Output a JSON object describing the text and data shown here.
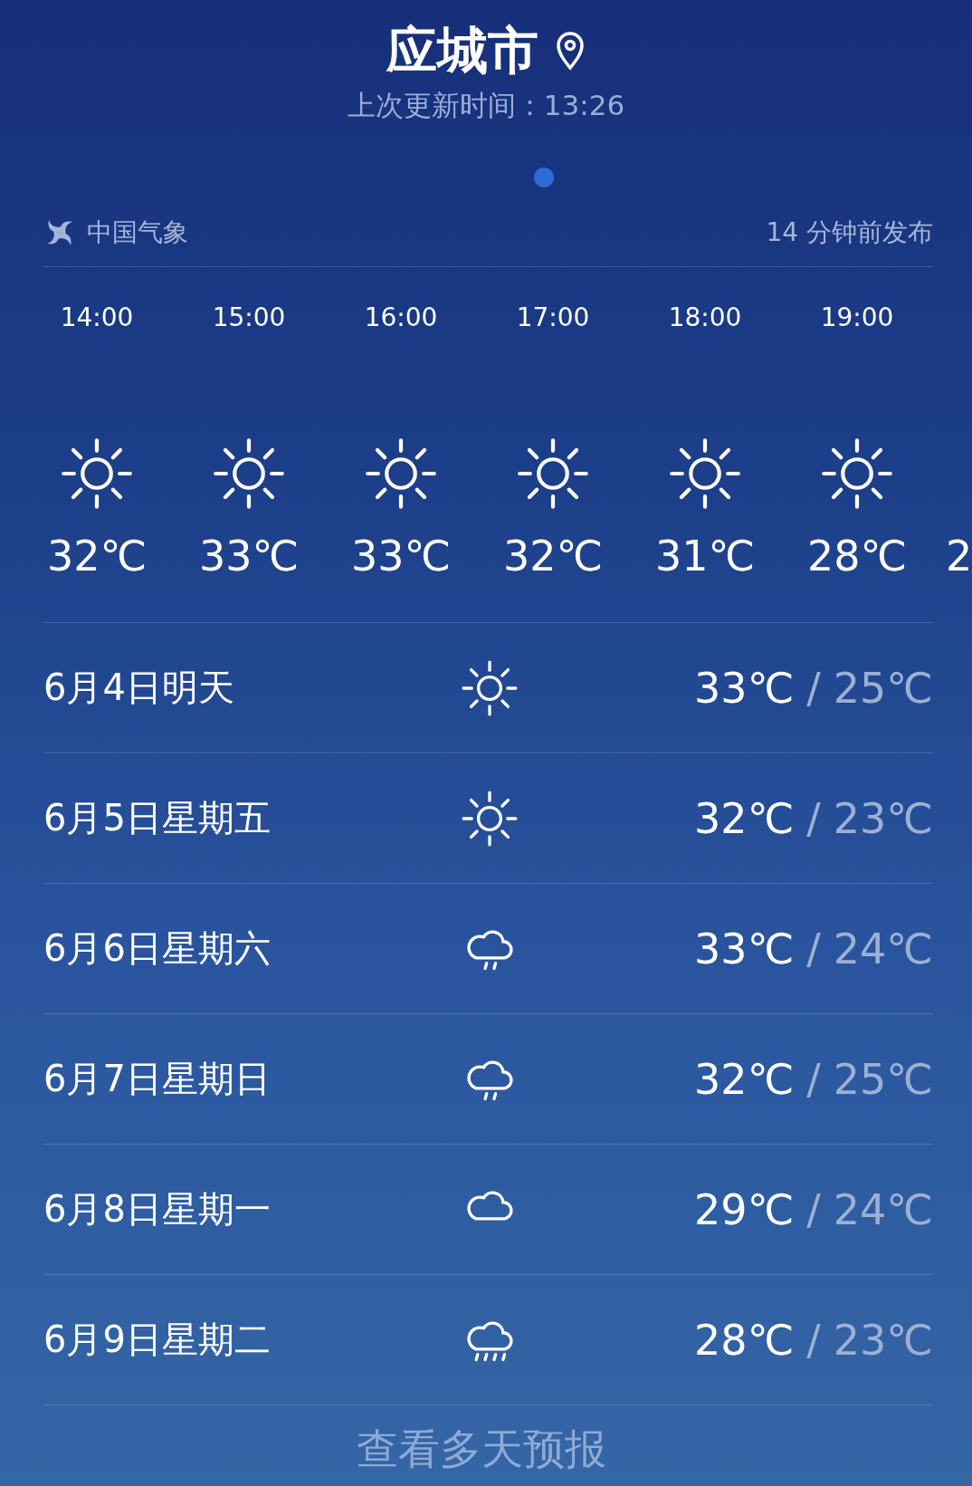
{
  "header": {
    "city": "应城市",
    "updated": "上次更新时间：13:26"
  },
  "source": {
    "name": "中国气象",
    "published": "14 分钟前发布"
  },
  "hourly": [
    {
      "time": "14:00",
      "kind": "sun",
      "temp": "32℃"
    },
    {
      "time": "15:00",
      "kind": "sun",
      "temp": "33℃"
    },
    {
      "time": "16:00",
      "kind": "sun",
      "temp": "33℃"
    },
    {
      "time": "17:00",
      "kind": "sun",
      "temp": "32℃"
    },
    {
      "time": "18:00",
      "kind": "sun",
      "temp": "31℃"
    },
    {
      "time": "19:00",
      "kind": "sun",
      "temp": "28℃"
    },
    {
      "temp": "2"
    }
  ],
  "daily": [
    {
      "date": "6月4日明天",
      "kind": "sun",
      "high": "33℃",
      "sep": "/",
      "low": "25℃"
    },
    {
      "date": "6月5日星期五",
      "kind": "sun",
      "high": "32℃",
      "sep": "/",
      "low": "23℃"
    },
    {
      "date": "6月6日星期六",
      "kind": "rain",
      "high": "33℃",
      "sep": "/",
      "low": "24℃"
    },
    {
      "date": "6月7日星期日",
      "kind": "rain",
      "high": "32℃",
      "sep": "/",
      "low": "25℃"
    },
    {
      "date": "6月8日星期一",
      "kind": "cloud",
      "high": "29℃",
      "sep": "/",
      "low": "24℃"
    },
    {
      "date": "6月9日星期二",
      "kind": "showers",
      "high": "28℃",
      "sep": "/",
      "low": "23℃"
    }
  ],
  "more_button": "查看多天预报"
}
